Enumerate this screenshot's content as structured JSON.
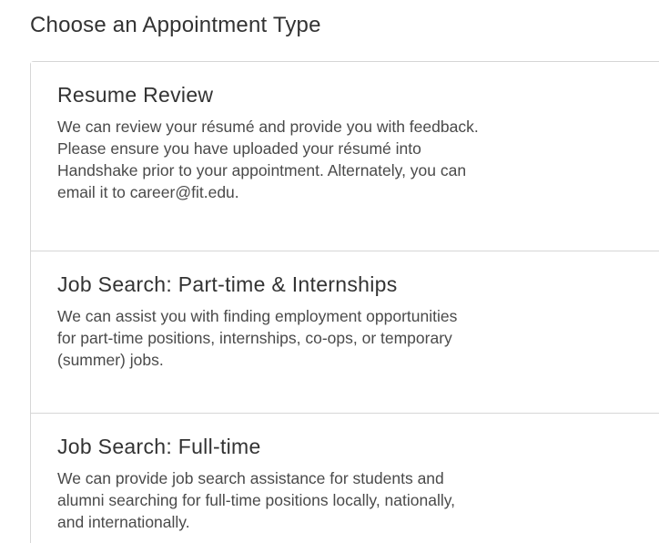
{
  "heading": "Choose an Appointment Type",
  "options": [
    {
      "title": "Resume Review",
      "description_lines": [
        "We can review your résumé and provide you with feedback.",
        "Please ensure you have uploaded your résumé into",
        "Handshake prior to your appointment. Alternately, you can",
        "email it to career@fit.edu."
      ]
    },
    {
      "title": "Job Search: Part-time & Internships",
      "description_lines": [
        "We can assist you with finding employment opportunities",
        "for part-time positions, internships, co-ops, or temporary",
        "(summer) jobs."
      ]
    },
    {
      "title": "Job Search: Full-time",
      "description_lines": [
        "We can provide job search assistance for students and",
        "alumni searching for full-time positions locally, nationally,",
        "and internationally."
      ]
    }
  ]
}
